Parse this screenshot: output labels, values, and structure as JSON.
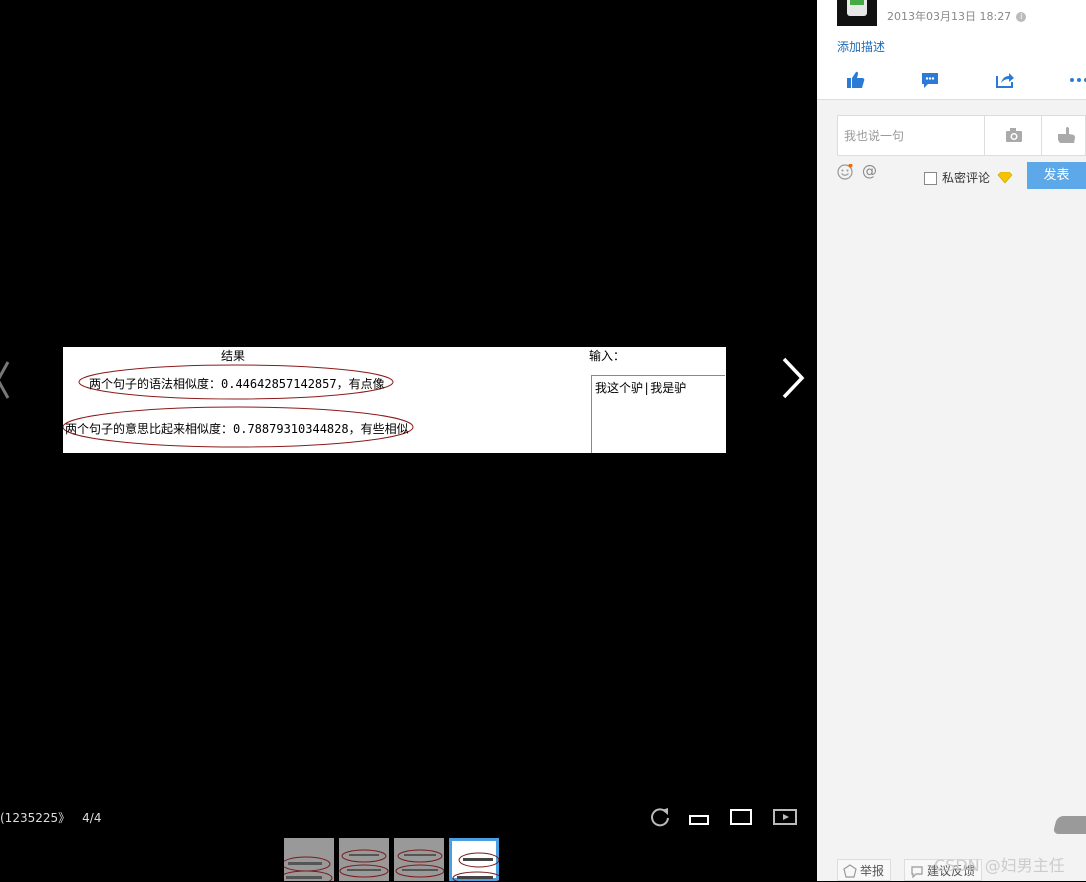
{
  "viewer": {
    "photo": {
      "result_title": "结果",
      "input_label": "输入：",
      "input_value": "我这个驴|我是驴",
      "line1": "两个句子的语法相似度：0.44642857142857，有点像",
      "line2": "两个句子的意思比起来相似度：0.78879310344828，有些相似"
    },
    "caption_id": "(1235225》",
    "page_indicator": "4/4"
  },
  "side": {
    "date": "2013年03月13日 18:27",
    "add_description": "添加描述",
    "comment_placeholder": "我也说一句",
    "private_label": "私密评论",
    "post_button": "发表",
    "report_button": "举报",
    "feedback_button": "建议反馈"
  },
  "watermark": "CSDN @妇男主任",
  "colors": {
    "accent": "#5da8e8",
    "link": "#1f6bb5",
    "ellipse": "#8b1a1a"
  }
}
